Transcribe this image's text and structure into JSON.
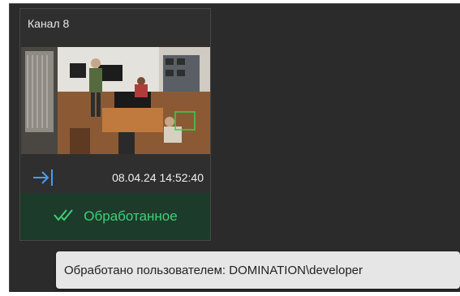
{
  "card": {
    "title": "Канал 8",
    "timestamp": "08.04.24 14:52:40",
    "status_label": "Обработанное",
    "icons": {
      "enter": "arrow-to-line-icon",
      "status": "double-check-icon"
    },
    "colors": {
      "accent_blue": "#4a9cf0",
      "status_green": "#3fcf77",
      "status_bg": "#1d3b2b"
    }
  },
  "tooltip": {
    "text": "Обработано пользователем: DOMINATION\\developer"
  }
}
